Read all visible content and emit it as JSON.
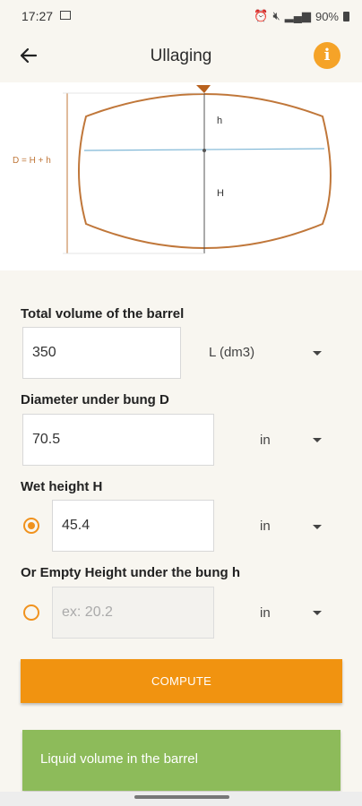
{
  "status_bar": {
    "time": "17:27",
    "battery": "90%"
  },
  "app_bar": {
    "title": "Ullaging",
    "info_label": "i"
  },
  "diagram": {
    "diameter_label": "D = H + h",
    "h_label": "h",
    "H_label": "H",
    "colors": {
      "barrel": "#c0773a",
      "liquid_line": "#7fb7d6",
      "bung": "#b8611d"
    }
  },
  "form": {
    "volume": {
      "label": "Total volume of the barrel",
      "value": "350",
      "unit": "L (dm3)"
    },
    "diameter": {
      "label": "Diameter under bung D",
      "value": "70.5",
      "unit": "in"
    },
    "wet_height": {
      "label": "Wet height H",
      "value": "45.4",
      "unit": "in",
      "selected": true
    },
    "empty_height": {
      "label": "Or Empty Height under the bung h",
      "placeholder": "ex: 20.2",
      "unit": "in",
      "selected": false
    }
  },
  "compute_button": {
    "label": "COMPUTE",
    "color": "#f19310"
  },
  "result": {
    "label": "Liquid volume in the barrel",
    "color": "#8dbb5a"
  }
}
